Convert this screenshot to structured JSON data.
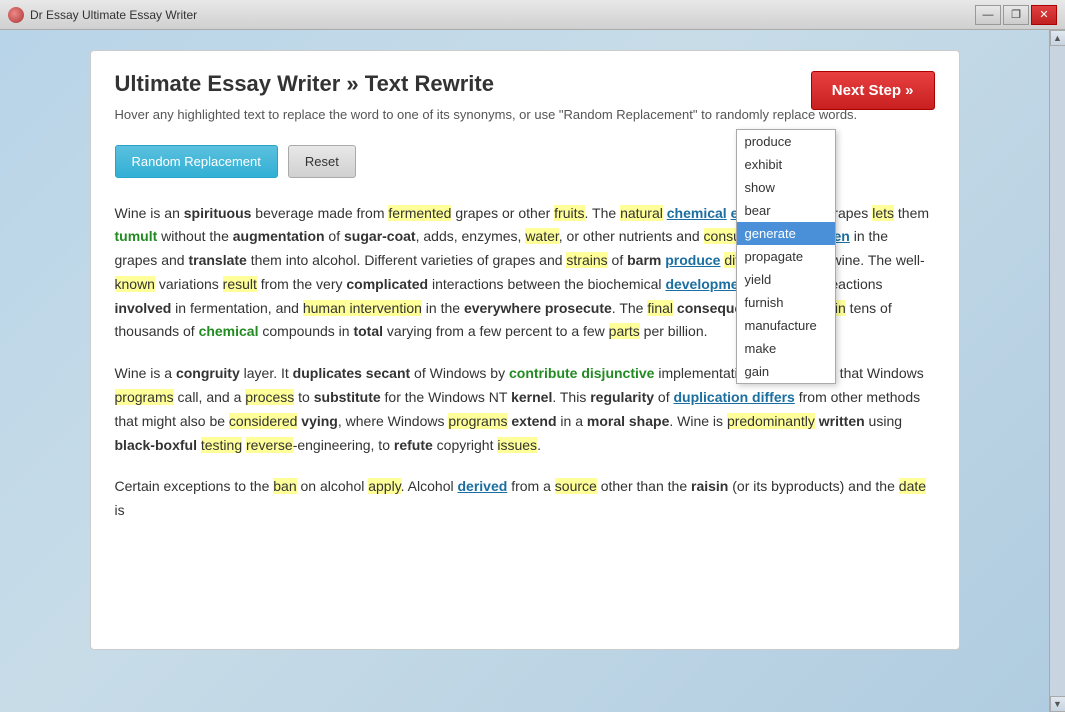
{
  "titleBar": {
    "title": "Dr Essay Ultimate Essay Writer",
    "controls": {
      "minimize": "—",
      "restore": "❐",
      "close": "✕"
    }
  },
  "panel": {
    "title": "Ultimate Essay Writer » Text Rewrite",
    "subtitle": "Hover any highlighted text to replace the word to one of its synonyms, or use \"Random Replacement\" to randomly replace words.",
    "buttons": {
      "random": "Random Replacement",
      "reset": "Reset",
      "next": "Next Step »"
    }
  },
  "dropdown": {
    "items": [
      {
        "label": "produce",
        "selected": false
      },
      {
        "label": "exhibit",
        "selected": false
      },
      {
        "label": "show",
        "selected": false
      },
      {
        "label": "bear",
        "selected": false
      },
      {
        "label": "generate",
        "selected": true
      },
      {
        "label": "propagate",
        "selected": false
      },
      {
        "label": "yield",
        "selected": false
      },
      {
        "label": "furnish",
        "selected": false
      },
      {
        "label": "manufacture",
        "selected": false
      },
      {
        "label": "make",
        "selected": false
      },
      {
        "label": "gain",
        "selected": false
      }
    ]
  },
  "essay": {
    "para1": "Wine is an spirituous beverage made from fermented grapes or other fruits. The natural chemical equilibrium of grapes lets them tumult without the augmentation of sugar-coat, adds, enzymes, water, or other nutrients and consumes the sweeten in the grapes and translate them into alcohol. Different varieties of grapes and strains of barm produce different types of wine. The well-known variations result from the very complicated interactions between the biochemical development of the fruit, reactions involved in fermentation, and human intervention in the everywhere prosecute. The final consequence may contain tens of thousands of chemical compounds in total varying from a few percent to a few parts per billion.",
    "para2": "Wine is a congruity layer. It duplicates secant of Windows by contribute disjunctive implementations of the DLLs that Windows programs call, and a process to substitute for the Windows NT kernel. This regularity of duplication differs from other methods that might also be considered vying, where Windows programs extend in a moral shape. Wine is predominantly written using black-boxful testing reverse-engineering, to refute copyright issues.",
    "para3": "Certain exceptions to the ban on alcohol apply. Alcohol derived from a source other than the raisin (or its byproducts) and the date is"
  },
  "scrollbar": {
    "upArrow": "▲",
    "downArrow": "▼"
  }
}
